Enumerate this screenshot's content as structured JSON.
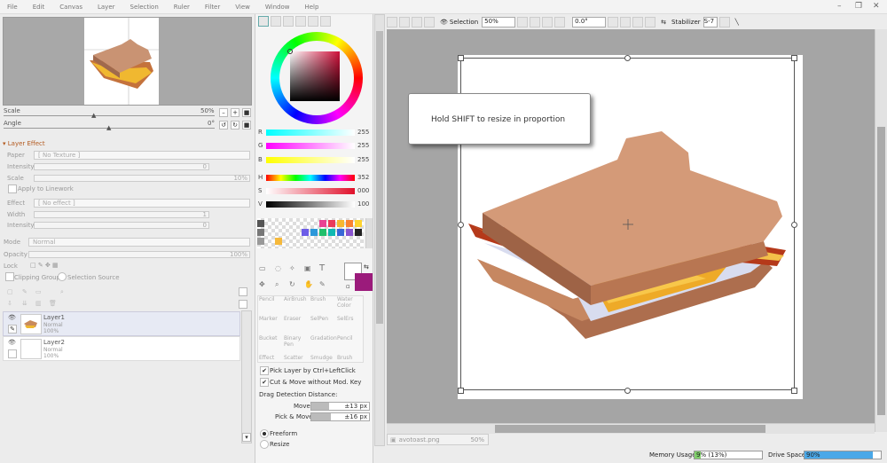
{
  "menu": [
    "File",
    "Edit",
    "Canvas",
    "Layer",
    "Selection",
    "Ruler",
    "Filter",
    "View",
    "Window",
    "Help"
  ],
  "navigator": {
    "scale_label": "Scale",
    "scale_value": "50%",
    "angle_label": "Angle",
    "angle_value": "0°"
  },
  "layer_effect": {
    "title": "Layer Effect",
    "paper_label": "Paper",
    "paper_value": "[ No Texture ]",
    "intensity_label": "Intensity",
    "intensity_value": "0",
    "scale_label": "Scale",
    "scale_value": "10%",
    "apply_linework": "Apply to Linework",
    "effect_label": "Effect",
    "effect_value": "[ No effect ]",
    "width_label": "Width",
    "width_value": "1",
    "intensity2_label": "Intensity",
    "intensity2_value": "0"
  },
  "layer_props": {
    "mode_label": "Mode",
    "mode_value": "Normal",
    "opacity_label": "Opacity",
    "opacity_value": "100%",
    "lock_label": "Lock",
    "clipping_group": "Clipping Group",
    "selection_source": "Selection Source"
  },
  "layers": [
    {
      "name": "Layer1",
      "mode": "Normal",
      "opacity": "100%"
    },
    {
      "name": "Layer2",
      "mode": "Normal",
      "opacity": "100%"
    }
  ],
  "color": {
    "r_label": "R",
    "r": "255",
    "g_label": "G",
    "g": "255",
    "b_label": "B",
    "b": "255",
    "h_label": "H",
    "h": "352",
    "s_label": "S",
    "s": "000",
    "v_label": "V",
    "v": "100",
    "fg": "#ffffff",
    "bg": "#9b1b7b"
  },
  "brushes": [
    [
      "Pencil",
      "AirBrush",
      "Brush",
      "Water Color"
    ],
    [
      "Marker",
      "Eraser",
      "SelPen",
      "SelErs"
    ],
    [
      "Bucket",
      "Binary Pen",
      "Gradation",
      "Pencil"
    ],
    [
      "Effect",
      "Scatter",
      "Smudge",
      "Brush"
    ]
  ],
  "options": {
    "pick_layer": "Pick Layer by Ctrl+LeftClick",
    "cut_move": "Cut & Move without Mod. Key",
    "drag_title": "Drag Detection Distance:",
    "move_label": "Move",
    "move_value": "±13 px",
    "pickmove_label": "Pick & Move",
    "pickmove_value": "±16 px",
    "freeform": "Freeform",
    "resize": "Resize"
  },
  "toolbar": {
    "selection_label": "Selection",
    "zoom": "50%",
    "rotation": "0.0°",
    "stabilizer_label": "Stabilizer",
    "stabilizer_value": "S-7"
  },
  "canvas": {
    "tooltip": "Hold SHIFT to resize in proportion"
  },
  "tab": {
    "filename": "avotoast.png",
    "zoom": "50%"
  },
  "status": {
    "memory_label": "Memory Usage",
    "memory_value": "9% (13%)",
    "memory_pct": 9,
    "drive_label": "Drive Space",
    "drive_value": "90%",
    "drive_pct": 90
  }
}
